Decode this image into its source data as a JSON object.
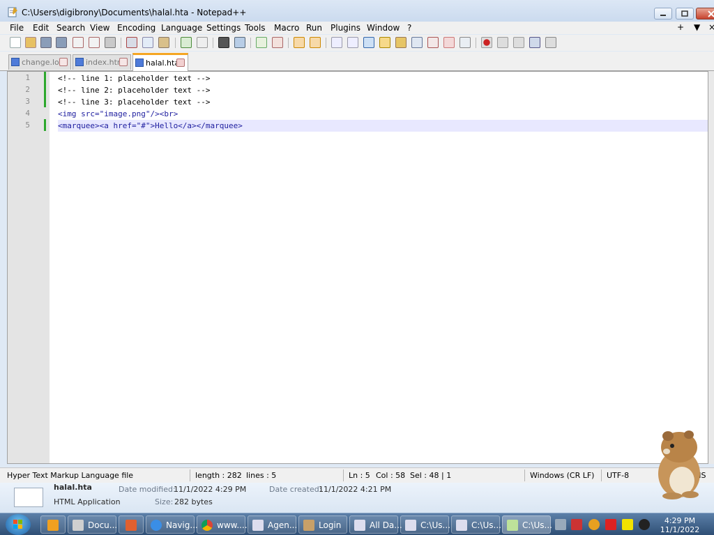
{
  "window": {
    "title": "C:\\Users\\digibrony\\Documents\\halal.hta - Notepad++"
  },
  "menu": {
    "items": [
      "File",
      "Edit",
      "Search",
      "View",
      "Encoding",
      "Language",
      "Settings",
      "Tools",
      "Macro",
      "Run",
      "Plugins",
      "Window",
      "?"
    ],
    "right": [
      "+",
      "▼",
      "×"
    ]
  },
  "tabs": [
    {
      "label": "change.log",
      "active": false
    },
    {
      "label": "index.html",
      "active": false
    },
    {
      "label": "halal.hta",
      "active": true
    }
  ],
  "editor": {
    "line_numbers": [
      "1",
      "2",
      "3",
      "4",
      "5"
    ],
    "lines": [
      "<!-- line 1: placeholder text -->",
      "<!-- line 2: placeholder text -->",
      "<!-- line 3: placeholder text -->",
      "<img src=\"image.png\"/><br>",
      "<marquee><a href=\"#\">Hello</a></marquee>"
    ],
    "current_line": 5
  },
  "status": {
    "file_type": "Hyper Text Markup Language file",
    "length": "length : 282",
    "lines": "lines : 5",
    "ln": "Ln : 5",
    "col": "Col : 58",
    "sel": "Sel : 48 | 1",
    "eol": "Windows (CR LF)",
    "encoding": "UTF-8",
    "mode": "INS"
  },
  "details": {
    "name": "halal.hta",
    "type": "HTML Application",
    "modified_label": "Date modified:",
    "modified": "11/1/2022 4:29 PM",
    "created_label": "Date created:",
    "created": "11/1/2022 4:21 PM",
    "size_label": "Size:",
    "size": "282 bytes"
  },
  "taskbar": {
    "items": [
      "Docu...",
      "Navig...",
      "www....",
      "Agen...",
      "Login",
      "All Da...",
      "C:\\Us...",
      "C:\\Us...",
      "C:\\Us..."
    ],
    "time": "4:29 PM",
    "date": "11/1/2022"
  },
  "colors": {
    "tab_active": "#f5a623",
    "modified_mark": "#2da82d",
    "current_line": "#e8e8ff"
  }
}
